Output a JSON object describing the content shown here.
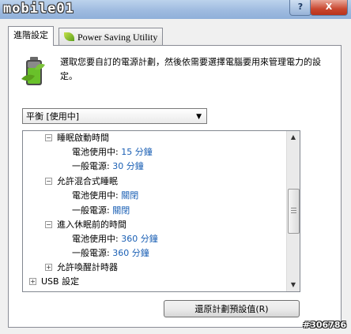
{
  "window": {
    "logo_text": "mobile01",
    "help_label": "?",
    "close_label": "X"
  },
  "tabs": [
    {
      "label": "進階設定",
      "active": true
    },
    {
      "label": "Power Saving Utility",
      "active": false,
      "icon": "leaf-icon"
    }
  ],
  "intro_text": "選取您要自訂的電源計劃，然後依需要選擇電腦要用來管理電力的設定。",
  "plan_select": {
    "value": "平衡 [使用中]"
  },
  "tree": [
    {
      "label": "睡眠啟動時間",
      "expander": "⊟",
      "level": 1
    },
    {
      "label": "電池使用中: ",
      "value": "15 分鐘",
      "level": 2
    },
    {
      "label": "一般電源: ",
      "value": "30 分鐘",
      "level": 2
    },
    {
      "label": "允許混合式睡眠",
      "expander": "⊟",
      "level": 1
    },
    {
      "label": "電池使用中: ",
      "value": "關閉",
      "level": 2
    },
    {
      "label": "一般電源: ",
      "value": "關閉",
      "level": 2
    },
    {
      "label": "進入休眠前的時間",
      "expander": "⊟",
      "level": 1
    },
    {
      "label": "電池使用中: ",
      "value": "360 分鐘",
      "level": 2
    },
    {
      "label": "一般電源: ",
      "value": "360 分鐘",
      "level": 2
    },
    {
      "label": "允許喚醒計時器",
      "expander": "⊞",
      "level": 1
    },
    {
      "label": "USB 設定",
      "expander": "⊞",
      "level": 0
    }
  ],
  "restore_button": "還原計劃預設值(R)",
  "watermark": "#306786",
  "colors": {
    "value_link": "#1a5fb4",
    "titlebar": "#9fbbe0"
  }
}
